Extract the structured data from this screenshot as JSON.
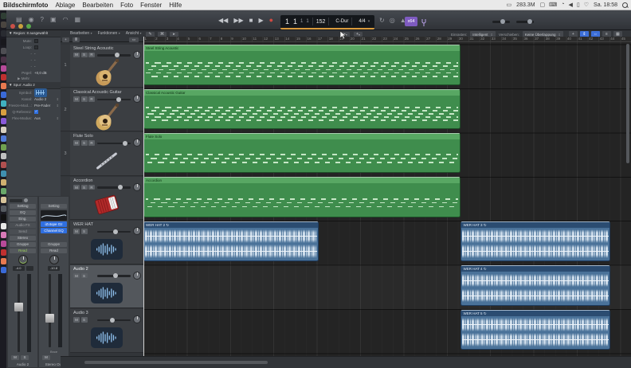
{
  "menubar": {
    "app_name": "Bildschirmfoto",
    "menus": [
      "Ablage",
      "Bearbeiten",
      "Foto",
      "Fenster",
      "Hilfe"
    ],
    "memory": "283.3M",
    "memory_icon": {
      "name": "memory-widget-icon",
      "glyph": "▭"
    },
    "status_icons": [
      {
        "name": "display-icon",
        "glyph": "▢"
      },
      {
        "name": "keyboard-icon",
        "glyph": "⌨"
      },
      {
        "name": "clock-icon",
        "glyph": "◔"
      },
      {
        "name": "volume-icon",
        "glyph": "◀"
      },
      {
        "name": "battery-icon",
        "glyph": "▯"
      },
      {
        "name": "sync-icon",
        "glyph": "♡"
      }
    ],
    "clock": "Sa. 18:58"
  },
  "window": {
    "toolbar_left_icons": [
      {
        "name": "library-icon",
        "glyph": "▤"
      },
      {
        "name": "inspector-icon",
        "glyph": "◉"
      },
      {
        "name": "quick-help-icon",
        "glyph": "?"
      },
      {
        "name": "toolbar-toggle-icon",
        "glyph": "▣"
      },
      {
        "name": "smart-controls-icon",
        "glyph": "◠"
      },
      {
        "name": "mixer-icon",
        "glyph": "▦"
      }
    ],
    "transport": [
      {
        "name": "rewind-button",
        "glyph": "◀◀"
      },
      {
        "name": "forward-button",
        "glyph": "▶▶"
      },
      {
        "name": "stop-button",
        "glyph": "■"
      },
      {
        "name": "play-button",
        "glyph": "▶"
      },
      {
        "name": "record-button",
        "glyph": "●"
      }
    ],
    "lcd": {
      "position_bar": "1",
      "position_beat": "1",
      "position_div": "1",
      "position_tick": "1",
      "tempo": "152",
      "key": "C-Dur",
      "time_signature": "4/4",
      "caret": "▾"
    },
    "lcd_icons": [
      {
        "name": "cycle-icon",
        "glyph": "↻"
      },
      {
        "name": "autopunch-icon",
        "glyph": "◎"
      },
      {
        "name": "metronome-icon",
        "glyph": "▲"
      }
    ],
    "badge_label": "x64"
  },
  "arrange_header": {
    "menus": [
      "Bearbeiten",
      "Funktionen",
      "Ansicht"
    ],
    "menu_caret": "▾",
    "add_track_glyph": "+",
    "track_header_config_glyph": "▭",
    "tool_icons": [
      {
        "name": "pencil-tool-icon",
        "glyph": "✎"
      },
      {
        "name": "command-tool-icon",
        "glyph": "⌘"
      },
      {
        "name": "pointer-tool-icon",
        "glyph": "▸",
        "active": true
      }
    ],
    "tool_menus": [
      {
        "name": "left-click-tool-menu",
        "glyph": "▸"
      },
      {
        "name": "command-click-tool-menu",
        "glyph": "+"
      }
    ],
    "snap_label": "Einrasten:",
    "snap_value": "Intelligent",
    "drag_label": "Verschieben:",
    "drag_value": "Keine Überlappung",
    "stepper_glyph": "⇕",
    "right_icons": [
      {
        "name": "catch-playhead-icon",
        "glyph": "+"
      },
      {
        "name": "auto-vertical-zoom-icon",
        "glyph": "⇕",
        "active": true
      },
      {
        "name": "auto-horizontal-zoom-icon",
        "glyph": "⇔",
        "active": true
      },
      {
        "name": "vertical-zoom-icon",
        "glyph": "≡"
      },
      {
        "name": "horizontal-zoom-icon",
        "glyph": "▦"
      }
    ]
  },
  "ruler": {
    "start": 1,
    "end": 45
  },
  "tracks": [
    {
      "number": "1",
      "name": "Steel String Acoustic",
      "buttons": [
        "M",
        "S",
        "R"
      ],
      "icon": "acoustic-guitar",
      "fader": 0.62,
      "selected": false
    },
    {
      "number": "2",
      "name": "Classical Acoustic Guitar",
      "buttons": [
        "M",
        "S",
        "R"
      ],
      "icon": "classical-guitar",
      "fader": 0.68,
      "selected": false
    },
    {
      "number": "3",
      "name": "Flute Solo",
      "buttons": [
        "M",
        "S",
        "R"
      ],
      "icon": "flute",
      "fader": 0.88,
      "selected": false
    },
    {
      "number": "4",
      "name": "Accordion",
      "buttons": [
        "M",
        "S",
        "R"
      ],
      "icon": "accordion",
      "fader": 0.72,
      "selected": false
    },
    {
      "number": "5",
      "name": "WER HAT",
      "buttons": [
        "M",
        "S"
      ],
      "icon": "waveform",
      "fader": 0.55,
      "selected": false
    },
    {
      "number": "6",
      "name": "Audio 2",
      "buttons": [
        "M",
        "S"
      ],
      "icon": "waveform",
      "fader": 0.55,
      "selected": true
    },
    {
      "number": "7",
      "name": "Audio 3",
      "buttons": [
        "M",
        "S"
      ],
      "icon": "waveform",
      "fader": 0.45,
      "selected": false
    }
  ],
  "regions": [
    {
      "name": "Steel String Acoustic",
      "type": "midi",
      "row": 1,
      "start_bar": 1,
      "end_bar": 30.3,
      "notes": "dense"
    },
    {
      "name": "Classical Acoustic Guitar",
      "type": "midi",
      "row": 2,
      "start_bar": 1,
      "end_bar": 30.3,
      "notes": "dense"
    },
    {
      "name": "Flute Solo",
      "type": "midi",
      "row": 3,
      "start_bar": 1,
      "end_bar": 30.3,
      "notes": "sparse"
    },
    {
      "name": "Accordion",
      "type": "midi",
      "row": 4,
      "start_bar": 1,
      "end_bar": 30.3,
      "notes": "sparse"
    },
    {
      "name": "WER HAT 2",
      "badge": "↻",
      "type": "audio",
      "row": 5,
      "start_bar": 1,
      "end_bar": 17.2
    },
    {
      "name": "WER HAT 3",
      "badge": "↻",
      "type": "audio",
      "row": 5,
      "start_bar": 30.3,
      "end_bar": 44.1
    },
    {
      "name": "WER HAT 4",
      "badge": "↻",
      "type": "audio",
      "row": 6,
      "start_bar": 30.3,
      "end_bar": 44.1
    },
    {
      "name": "WER HAT 5",
      "badge": "↻",
      "type": "audio",
      "row": 7,
      "start_bar": 30.3,
      "end_bar": 44.1
    }
  ],
  "inspector": {
    "disclosure": "▼",
    "more_arrow": "▶",
    "region_section": {
      "title": "Region: 8 ausgewählt",
      "rows": [
        {
          "label": "Mute:",
          "value": "",
          "control": "checkbox",
          "checked": false
        },
        {
          "label": "Loop:",
          "value": "",
          "control": "checkbox",
          "checked": false
        },
        {
          "label": "-",
          "value": "-"
        },
        {
          "label": "-",
          "value": "-"
        },
        {
          "label": "-",
          "value": "-"
        },
        {
          "label": "Pegel:",
          "value": "+0,0 dB"
        }
      ],
      "more": "Mehr"
    },
    "track_section": {
      "title": "Spur: Audio 2",
      "rows": [
        {
          "label": "Symbol:",
          "value": "",
          "control": "icon"
        },
        {
          "label": "Kanal:",
          "value": "Audio 2",
          "control": "select"
        },
        {
          "label": "Freeze-Mod...:",
          "value": "Pre-Fader",
          "control": "select"
        },
        {
          "label": "Q-Referenz:",
          "value": "✓",
          "control": "checkbox",
          "checked": true
        },
        {
          "label": "Flex-Modus:",
          "value": "Aus",
          "control": "select"
        }
      ]
    }
  },
  "channel_strips": [
    {
      "label": "Audio 2",
      "slots": [
        "Setting",
        "EQ",
        "Eing.",
        "Audio FX",
        "Send",
        "Stereo",
        "Gruppe",
        "Read"
      ],
      "volume": "-4.0",
      "fader": 0.38,
      "buttons": [
        "M",
        "S"
      ]
    },
    {
      "label": "Stereo Out",
      "setting": "Setting",
      "plugins": [
        "iZotope Oz",
        "Channel EQ"
      ],
      "slots2": [
        "Gruppe",
        "Read"
      ],
      "volume": "-10.8",
      "fader": 0.55,
      "bounce": "Bnce",
      "buttons": [
        "M"
      ]
    }
  ],
  "dock_colors": [
    "#6aa86a",
    "#d8c49a",
    "#555a60",
    "#111111",
    "#e8e8e8",
    "#d87ab8",
    "#b84a9a",
    "#c03030",
    "#e87a50",
    "#3a6ad8",
    "#40b0c0",
    "#d8a040",
    "#8a5ad8",
    "#d8d0c0",
    "#507ad8",
    "#70a050",
    "#c0c0c0",
    "#b05050",
    "#4090b0",
    "#d0b070"
  ],
  "colors": {
    "midi_region": "#3f8d4d",
    "midi_region_header": "#58a763",
    "audio_region": "#4a7299",
    "audio_region_header": "#2b4c71",
    "lcd_underline": "#d99a3c",
    "badge_purple": "#7e5bc0",
    "accent_blue": "#3d6fd8",
    "automation_read_green": "#9ccf5e"
  }
}
